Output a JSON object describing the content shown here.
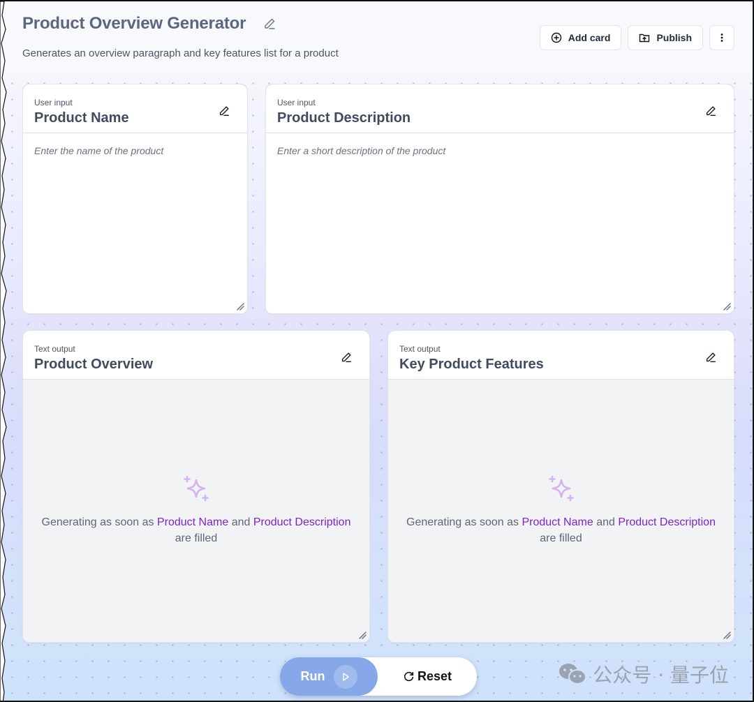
{
  "header": {
    "title": "Product Overview Generator",
    "subtitle": "Generates an overview paragraph and key features list for a product"
  },
  "toolbar": {
    "add_card_label": "Add card",
    "publish_label": "Publish"
  },
  "cards": [
    {
      "type": "User input",
      "title": "Product Name",
      "placeholder": "Enter the name of the product",
      "value": ""
    },
    {
      "type": "User input",
      "title": "Product Description",
      "placeholder": "Enter a short description of the product",
      "value": ""
    },
    {
      "type": "Text output",
      "title": "Product Overview",
      "status_prefix": "Generating as soon as",
      "ref1": "Product Name",
      "joiner": "and",
      "ref2": "Product Description",
      "status_suffix": "are filled"
    },
    {
      "type": "Text output",
      "title": "Key Product Features",
      "status_prefix": "Generating as soon as",
      "ref1": "Product Name",
      "joiner": "and",
      "ref2": "Product Description",
      "status_suffix": "are filled"
    }
  ],
  "actions": {
    "run_label": "Run",
    "reset_label": "Reset"
  },
  "watermark": {
    "text": "公众号 · 量子位"
  },
  "colors": {
    "input_accent": "#1d5fd3",
    "output_accent": "#7e22ce",
    "run_button": "#86a8e8",
    "sparkle": "#d3b3f5"
  }
}
